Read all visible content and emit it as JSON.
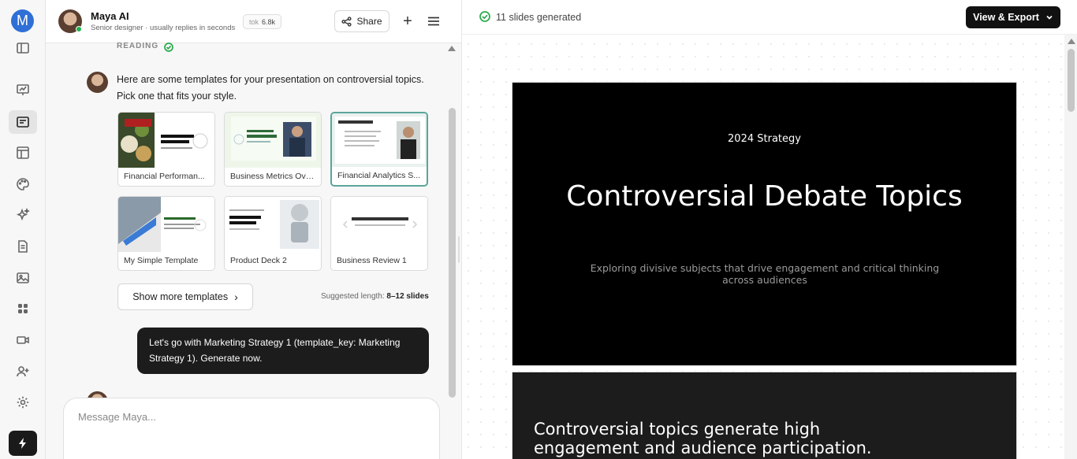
{
  "rail": {
    "avatar_letter": "M"
  },
  "chat_header": {
    "name": "Maya AI",
    "subtitle": "Senior designer · usually replies in seconds",
    "tok_label": "tok",
    "tok_value": "6.8k",
    "share_label": "Share"
  },
  "chat": {
    "reading_label": "READING",
    "assistant_message": "Here are some templates for your presentation on controversial topics. Pick one that fits your style.",
    "templates": [
      {
        "label": "Financial Performan..."
      },
      {
        "label": "Business Metrics Ove..."
      },
      {
        "label": "Financial Analytics S..."
      },
      {
        "label": "My Simple Template"
      },
      {
        "label": "Product Deck 2"
      },
      {
        "label": "Business Review 1"
      }
    ],
    "show_more_label": "Show more templates",
    "suggested_prefix": "Suggested length:",
    "suggested_value": "8–12 slides",
    "user_message": "Let's go with Marketing Strategy 1 (template_key: Marketing Strategy 1). Generate now.",
    "composer_placeholder": "Message Maya..."
  },
  "preview": {
    "status_text": "11 slides generated",
    "export_label": "View & Export",
    "slide1": {
      "tag": "2024 Strategy",
      "title": "Controversial Debate Topics",
      "subtitle": "Exploring divisive subjects that drive engagement and critical thinking across audiences"
    },
    "slide2": {
      "text": "Controversial topics generate high engagement and audience participation."
    }
  }
}
